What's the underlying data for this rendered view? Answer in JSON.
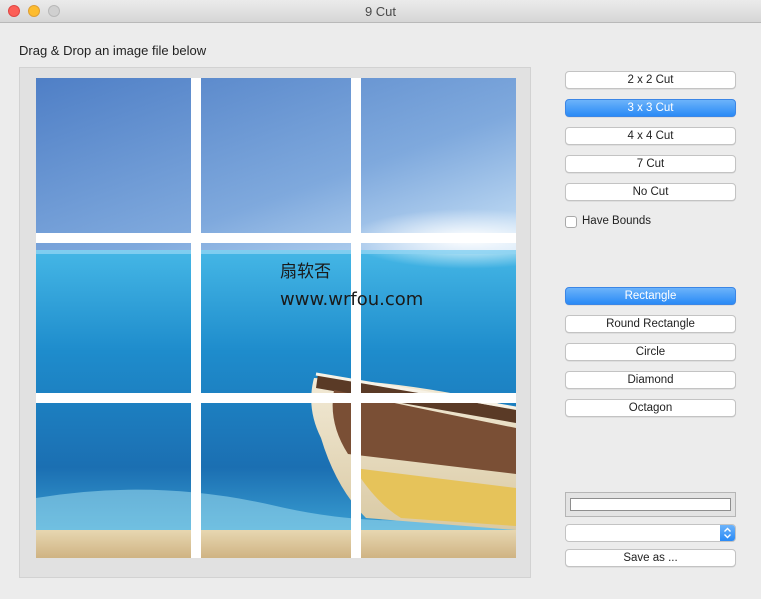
{
  "window": {
    "title": "9 Cut"
  },
  "instruction": "Drag & Drop an image file below",
  "watermark": {
    "line1": "扇软否",
    "line2": "www.wrfou.com"
  },
  "cut_buttons": [
    {
      "label": "2 x 2 Cut",
      "selected": false
    },
    {
      "label": "3 x 3 Cut",
      "selected": true
    },
    {
      "label": "4 x 4 Cut",
      "selected": false
    },
    {
      "label": "7 Cut",
      "selected": false
    },
    {
      "label": "No Cut",
      "selected": false
    }
  ],
  "have_bounds": {
    "label": "Have Bounds",
    "checked": false
  },
  "shape_buttons": [
    {
      "label": "Rectangle",
      "selected": true
    },
    {
      "label": "Round Rectangle",
      "selected": false
    },
    {
      "label": "Circle",
      "selected": false
    },
    {
      "label": "Diamond",
      "selected": false
    },
    {
      "label": "Octagon",
      "selected": false
    }
  ],
  "format_select": {
    "value": ""
  },
  "save_button": {
    "label": "Save as ..."
  },
  "colors": {
    "accent": "#2a8af6",
    "grid_line": "#ffffff",
    "sky": "#6b9ad8",
    "sea": "#2a8fd0",
    "sand": "#dcc79a"
  }
}
